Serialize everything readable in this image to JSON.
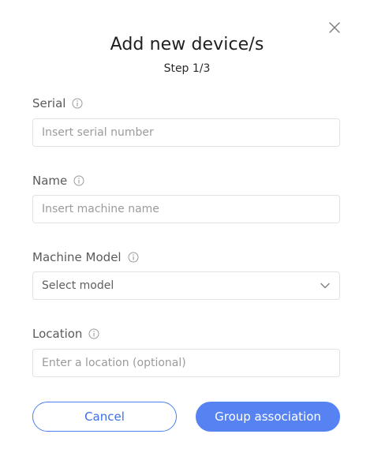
{
  "dialog": {
    "title": "Add new device/s",
    "step": "Step 1/3"
  },
  "fields": {
    "serial": {
      "label": "Serial",
      "placeholder": "Insert serial number"
    },
    "name": {
      "label": "Name",
      "placeholder": "Insert machine name"
    },
    "model": {
      "label": "Machine Model",
      "selected": "Select model"
    },
    "location": {
      "label": "Location",
      "placeholder": "Enter a location (optional)"
    }
  },
  "actions": {
    "cancel_label": "Cancel",
    "primary_label": "Group association"
  },
  "icons": {
    "close": "close-icon",
    "info": "info-icon",
    "dropdown": "chevron-down-icon"
  },
  "colors": {
    "accent": "#5783f2",
    "accent_text": "#3e6fe4",
    "border": "#e2e2e2",
    "placeholder": "#9b9b9b"
  }
}
